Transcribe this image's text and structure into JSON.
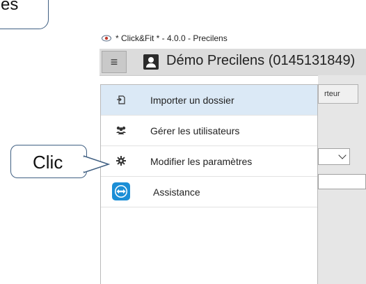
{
  "callout_top": {
    "text": "es"
  },
  "window": {
    "title": "* Click&Fit * - 4.0.0 - Precilens",
    "eye_icon": "eye-icon"
  },
  "header": {
    "menu_icon": "≡",
    "title": "Démo Precilens (0145131849)"
  },
  "background": {
    "tab_label": "rteur"
  },
  "menu": {
    "items": [
      {
        "label": "Importer un dossier",
        "icon": "import-icon",
        "highlighted": true
      },
      {
        "label": "Gérer les utilisateurs",
        "icon": "users-icon",
        "highlighted": false
      },
      {
        "label": "Modifier les paramètres",
        "icon": "gear-icon",
        "highlighted": false
      },
      {
        "label": "Assistance",
        "icon": "teamviewer-icon",
        "highlighted": false
      }
    ]
  },
  "annotation": {
    "label": "Clic",
    "border_color": "#3f5f82"
  },
  "colors": {
    "highlight": "#dbe9f6",
    "header_bg": "#dcdcdc",
    "teamviewer_blue": "#1b8ed6"
  }
}
